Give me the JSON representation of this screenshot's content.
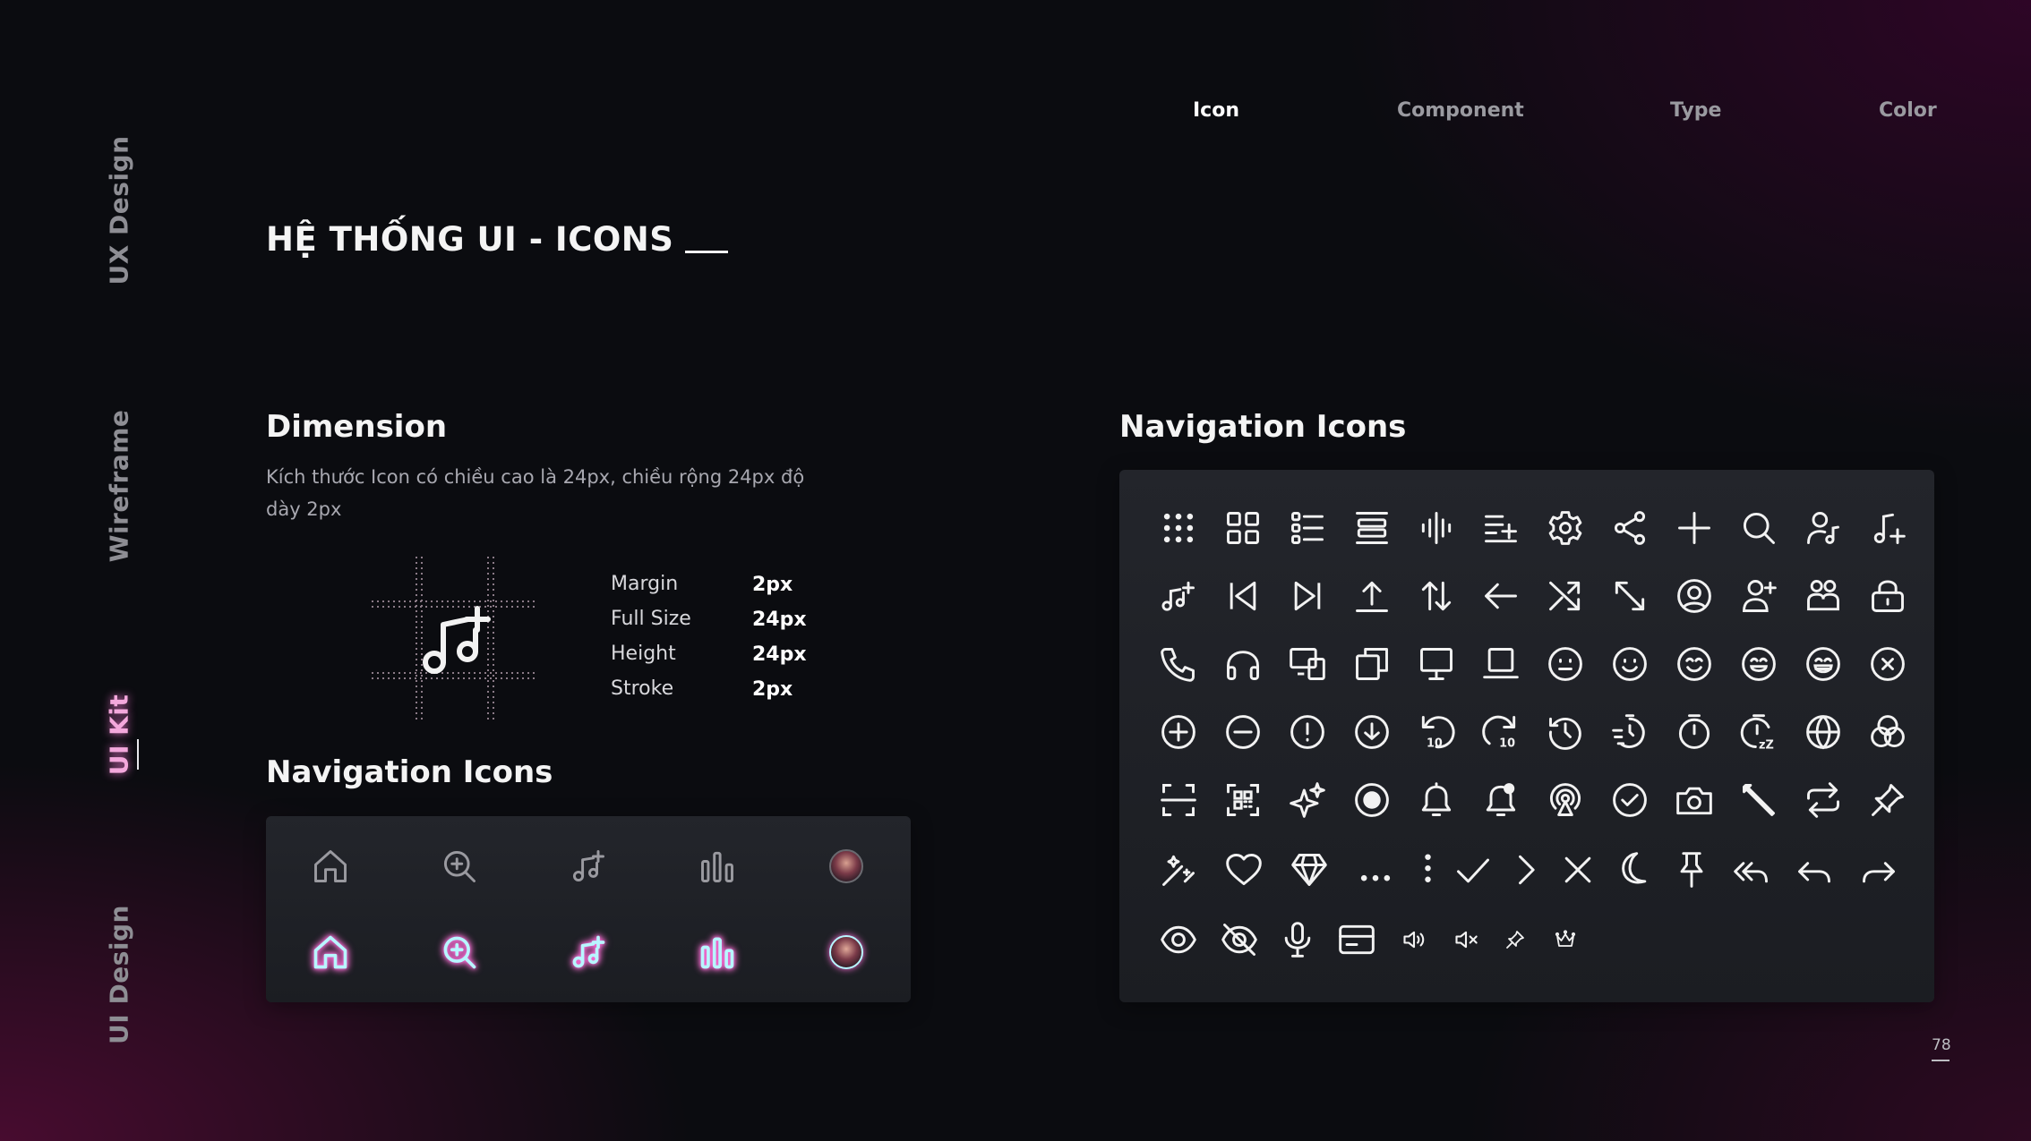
{
  "side_nav": [
    {
      "label": "UX Design",
      "active": false
    },
    {
      "label": "Wireframe",
      "active": false
    },
    {
      "label": "UI Kit",
      "active": true
    },
    {
      "label": "UI Design",
      "active": false
    }
  ],
  "top_nav": [
    {
      "label": "Icon",
      "active": true
    },
    {
      "label": "Component",
      "active": false
    },
    {
      "label": "Type",
      "active": false
    },
    {
      "label": "Color",
      "active": false
    }
  ],
  "page_title": "HỆ THỐNG UI - ICONS",
  "dimension": {
    "title": "Dimension",
    "description": "Kích thước Icon có chiều cao là 24px, chiều rộng 24px độ dày 2px",
    "specs": [
      {
        "label": "Margin",
        "value": "2px"
      },
      {
        "label": "Full Size",
        "value": "24px"
      },
      {
        "label": "Height",
        "value": "24px"
      },
      {
        "label": "Stroke",
        "value": "2px"
      }
    ]
  },
  "nav_icons_small": {
    "title": "Navigation Icons",
    "icons": [
      "home-icon",
      "zoom-in-icon",
      "music-add-icon",
      "chart-bars-icon",
      "avatar"
    ],
    "colors": {
      "inactive": "#9a9aa0",
      "glow": "#ff6fd8",
      "active": "#7ef0ff"
    }
  },
  "nav_icons_grid": {
    "title": "Navigation Icons",
    "rows": [
      [
        "dots-grid-icon",
        "grid-icon",
        "list-icon",
        "align-center-icon",
        "audio-wave-icon",
        "list-add-icon",
        "gear-icon",
        "share-icon",
        "plus-icon",
        "search-icon",
        "user-music-icon",
        "music-note-plus-icon"
      ],
      [
        "music-notes-icon",
        "skip-back-icon",
        "skip-forward-icon",
        "upload-icon",
        "sort-arrows-icon",
        "arrow-left-icon",
        "shuffle-icon",
        "expand-icon",
        "user-circle-icon",
        "user-add-icon",
        "users-icon",
        "lock-icon"
      ],
      [
        "phone-icon",
        "headphones-icon",
        "devices-icon",
        "copy-icon",
        "monitor-icon",
        "laptop-icon",
        "smile-icon",
        "happy-icon",
        "grin-icon",
        "laugh-icon",
        "joy-icon",
        "close-circle-icon"
      ],
      [
        "add-circle-icon",
        "minus-circle-icon",
        "alert-circle-icon",
        "download-circle-icon",
        "rewind-10-icon",
        "forward-10-icon",
        "history-icon",
        "timer-fast-icon",
        "stopwatch-icon",
        "sleep-timer-icon",
        "globe-icon",
        "colors-icon"
      ],
      [
        "scan-icon",
        "qr-code-icon",
        "sparkle-icon",
        "record-icon",
        "bell-icon",
        "bell-badge-icon",
        "broadcast-icon",
        "check-circle-icon",
        "camera-icon",
        "pencil-icon",
        "repeat-icon",
        "pin-tilted-icon"
      ],
      [
        "magic-wand-icon",
        "heart-icon",
        "diamond-icon",
        "more-horizontal-icon",
        "more-vertical-icon",
        "check-icon",
        "chevron-right-icon",
        "close-icon",
        "moon-icon",
        "pin-icon",
        "reply-all-icon",
        "reply-icon",
        "forward-icon"
      ],
      [
        "eye-icon",
        "eye-off-icon",
        "microphone-icon",
        "card-icon",
        "volume-icon",
        "mute-icon",
        "pin-small-icon",
        "crown-icon"
      ]
    ]
  },
  "page_number": "78"
}
